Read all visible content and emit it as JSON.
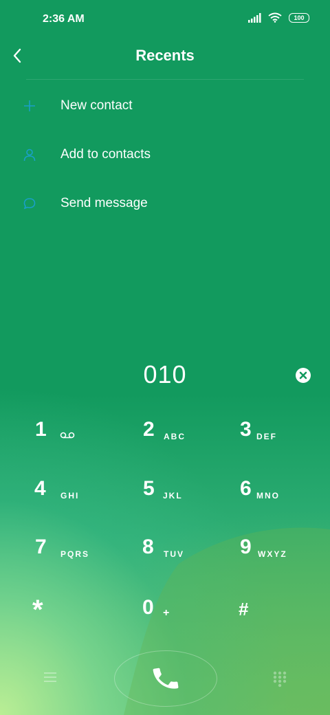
{
  "status_bar": {
    "time": "2:36 AM",
    "battery": "100"
  },
  "header": {
    "title": "Recents"
  },
  "menu": [
    {
      "label": "New contact",
      "icon": "plus-icon"
    },
    {
      "label": "Add to contacts",
      "icon": "person-icon"
    },
    {
      "label": "Send message",
      "icon": "chat-bubble-icon"
    }
  ],
  "dialer": {
    "number": "010"
  },
  "keypad": [
    {
      "digit": "1",
      "letters": ""
    },
    {
      "digit": "2",
      "letters": "ABC"
    },
    {
      "digit": "3",
      "letters": "DEF"
    },
    {
      "digit": "4",
      "letters": "GHI"
    },
    {
      "digit": "5",
      "letters": "JKL"
    },
    {
      "digit": "6",
      "letters": "MNO"
    },
    {
      "digit": "7",
      "letters": "PQRS"
    },
    {
      "digit": "8",
      "letters": "TUV"
    },
    {
      "digit": "9",
      "letters": "WXYZ"
    },
    {
      "digit": "*",
      "letters": ""
    },
    {
      "digit": "0",
      "letters": "+"
    },
    {
      "digit": "#",
      "letters": ""
    }
  ],
  "colors": {
    "background": "#129a5e",
    "icon_accent": "#1aa0c8",
    "text": "#ffffff"
  }
}
